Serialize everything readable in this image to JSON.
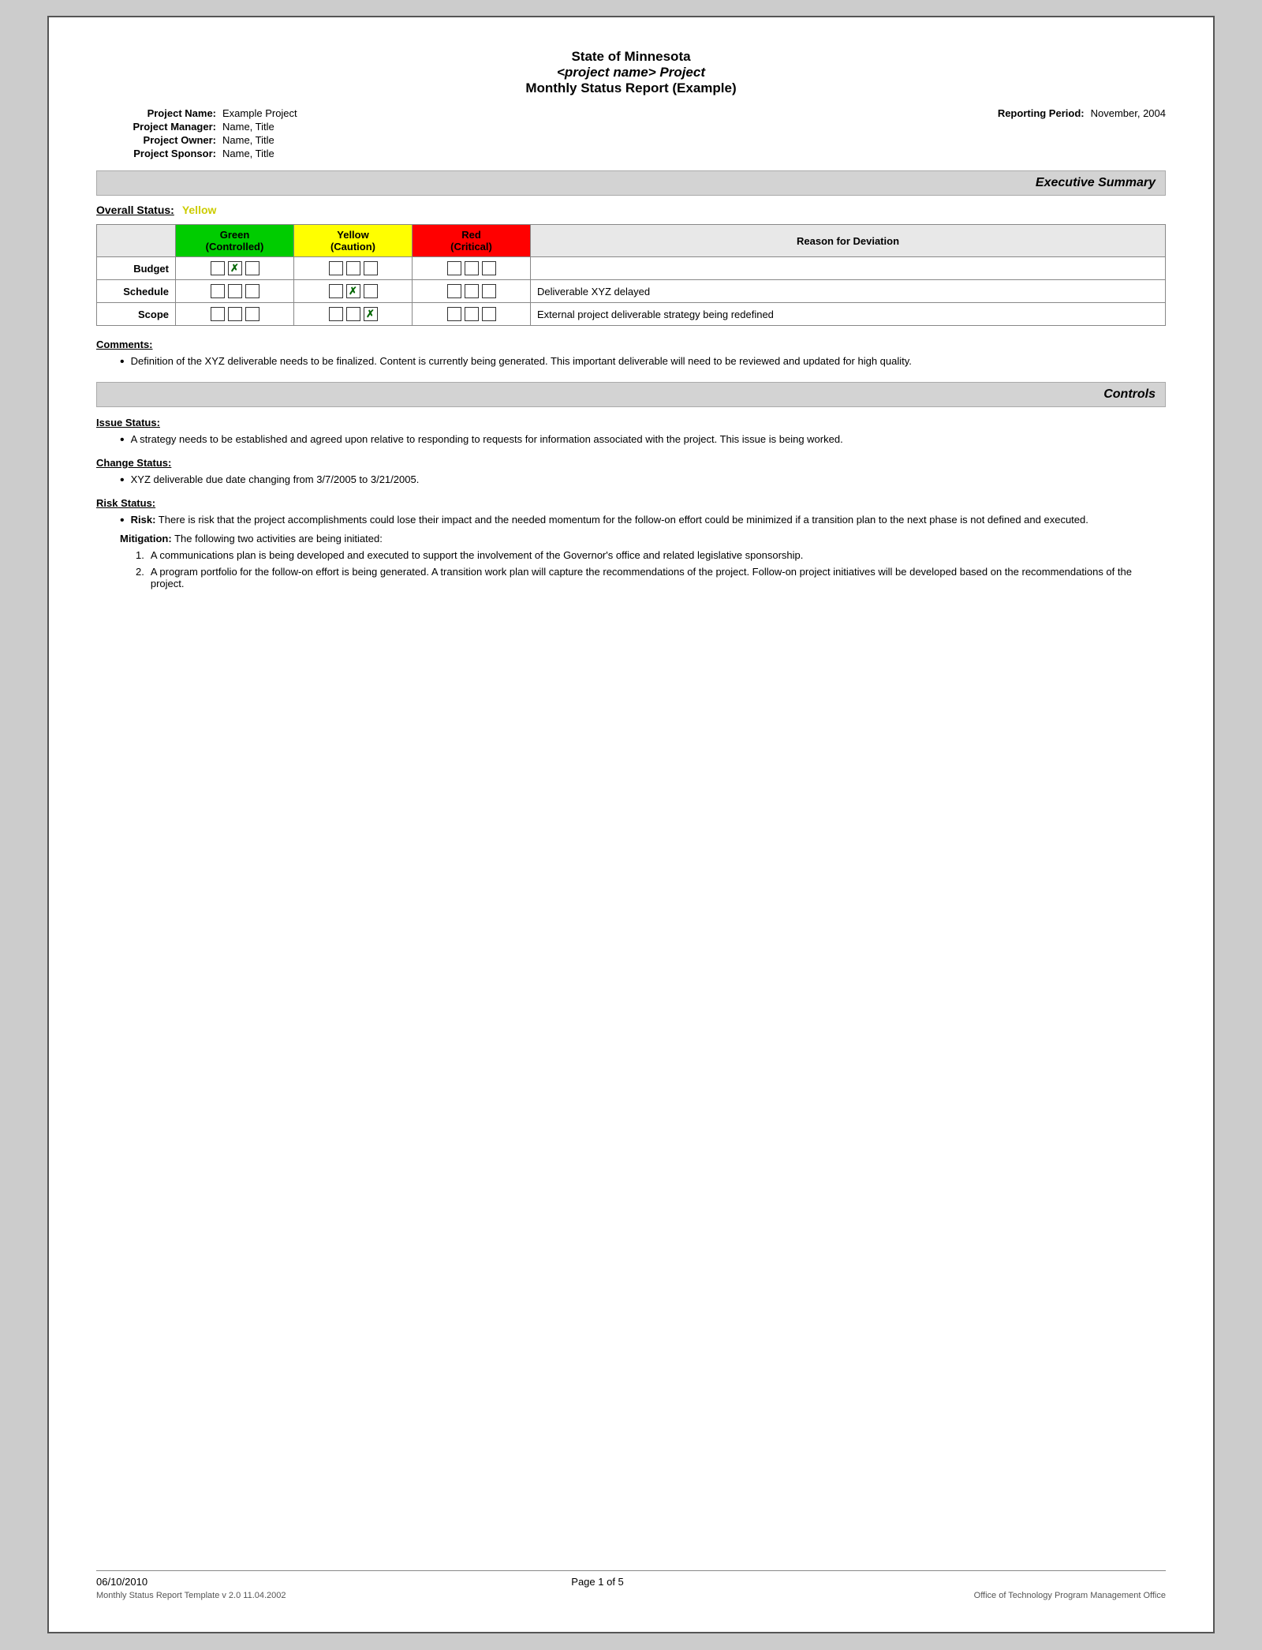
{
  "page": {
    "border_color": "#555"
  },
  "header": {
    "line1": "State of Minnesota",
    "line2": "<project name> Project",
    "line3": "Monthly Status Report (Example)"
  },
  "project_info": {
    "name_label": "Project Name:",
    "name_value": "Example Project",
    "reporting_period_label": "Reporting Period:",
    "reporting_period_value": "November, 2004",
    "manager_label": "Project Manager:",
    "manager_value": "Name, Title",
    "owner_label": "Project Owner:",
    "owner_value": "Name, Title",
    "sponsor_label": "Project Sponsor:",
    "sponsor_value": "Name, Title"
  },
  "executive_summary": {
    "section_label": "Executive Summary",
    "overall_status_label": "Overall Status:",
    "overall_status_value": "Yellow",
    "table": {
      "col_green_label": "Green",
      "col_green_sub": "(Controlled)",
      "col_yellow_label": "Yellow",
      "col_yellow_sub": "(Caution)",
      "col_red_label": "Red",
      "col_red_sub": "(Critical)",
      "col_reason_label": "Reason for Deviation",
      "rows": [
        {
          "label": "Budget",
          "green": [
            false,
            true,
            false
          ],
          "yellow": [
            false,
            false,
            false
          ],
          "red": [
            false,
            false,
            false
          ],
          "reason": ""
        },
        {
          "label": "Schedule",
          "green": [
            false,
            false,
            false
          ],
          "yellow": [
            false,
            true,
            false
          ],
          "red": [
            false,
            false,
            false
          ],
          "reason": "Deliverable XYZ delayed"
        },
        {
          "label": "Scope",
          "green": [
            false,
            false,
            false
          ],
          "yellow": [
            false,
            false,
            true
          ],
          "red": [
            false,
            false,
            false
          ],
          "reason": "External project deliverable strategy being redefined"
        }
      ]
    },
    "comments_label": "Comments:",
    "comments": [
      "Definition of the XYZ deliverable needs to be finalized.  Content is currently being generated.  This important deliverable will need to be reviewed and updated for high quality."
    ]
  },
  "controls": {
    "section_label": "Controls",
    "issue_status_label": "Issue Status:",
    "issue_bullets": [
      "A strategy needs to be established and agreed upon relative to responding to requests for information associated with the project.  This issue is being worked."
    ],
    "change_status_label": "Change Status:",
    "change_bullets": [
      "XYZ deliverable due date changing from 3/7/2005 to 3/21/2005."
    ],
    "risk_status_label": "Risk Status:",
    "risk_bullets": [
      {
        "bold_prefix": "Risk:",
        "text": " There is risk that the project accomplishments could lose their impact and the needed momentum for the follow-on effort could be minimized if a transition plan to the next phase is not defined and executed."
      }
    ],
    "mitigation_label": "Mitigation:",
    "mitigation_intro": " The following two activities are being initiated:",
    "mitigation_items": [
      "A communications plan is being developed and executed to support the involvement of the Governor's office and related legislative sponsorship.",
      "A program portfolio for the follow-on effort is being generated. A transition work plan will capture the recommendations of the project. Follow-on project initiatives will be developed based on the recommendations of the project."
    ]
  },
  "footer": {
    "date": "06/10/2010",
    "page_label": "Page 1 of 5",
    "template_label": "Monthly Status Report Template  v 2.0  11.04.2002",
    "office_label": "Office of Technology Program Management Office"
  }
}
